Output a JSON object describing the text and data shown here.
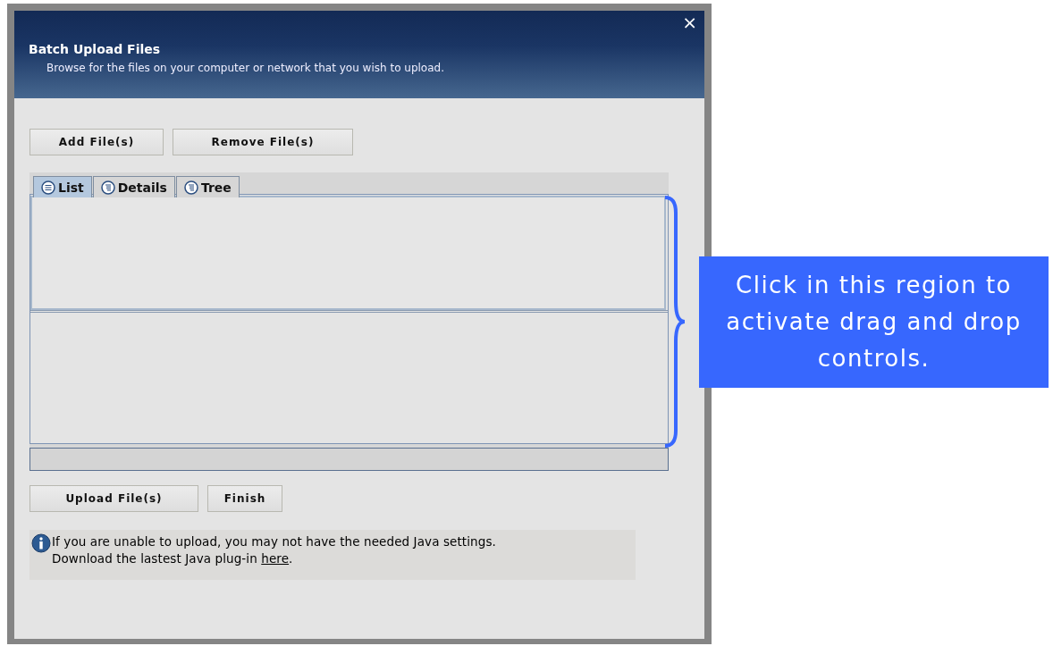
{
  "window": {
    "title": "Batch Upload Files",
    "subtitle": "Browse for the files on your computer or network that you wish to upload.",
    "close": "×"
  },
  "top_buttons": [
    "Add File(s)",
    "Remove File(s)"
  ],
  "tabs": [
    {
      "label": "List",
      "selected": true
    },
    {
      "label": "Details",
      "selected": false
    },
    {
      "label": "Tree",
      "selected": false
    }
  ],
  "bottom_buttons": [
    "Upload File(s)",
    "Finish"
  ],
  "notice": {
    "line_1": "If you are unable to upload, you may not have the needed Java settings.",
    "line_2": "Download the lastest Java plug-in ",
    "link": "here",
    "after_link": "."
  },
  "callout": {
    "text": "Click in this region to activate drag and drop controls."
  }
}
